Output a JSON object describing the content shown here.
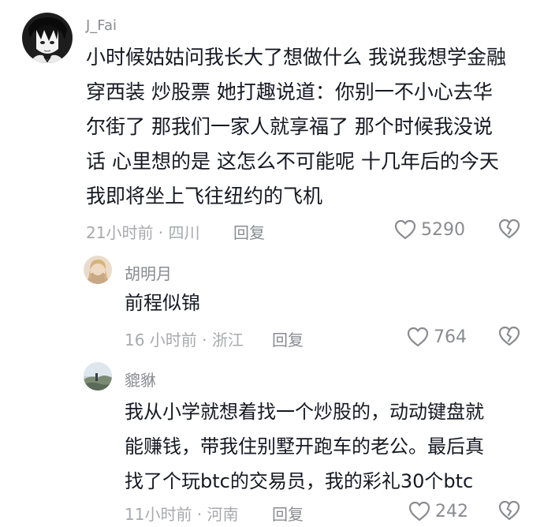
{
  "comments": [
    {
      "username": "J_Fai",
      "lines": [
        "小时候姑姑问我长大了想做什么 我说我想学金融",
        "穿西装 炒股票 她打趣说道：你别一不小心去华",
        "尔街了 那我们一家人就享福了 那个时候我没说",
        "话 心里想的是 这怎么不可能呢 十几年后的今天",
        "我即将坐上飞往纽约的飞机"
      ],
      "meta": "21小时前 · 四川",
      "reply_label": "回复",
      "likes": "5290"
    },
    {
      "username": "胡明月",
      "lines": [
        "前程似锦"
      ],
      "meta": "16 小时前 · 浙江",
      "reply_label": "回复",
      "likes": "764"
    },
    {
      "username": "貔貅",
      "lines": [
        "我从小学就想着找一个炒股的，动动键盘就",
        "能赚钱，带我住别墅开跑车的老公。最后真",
        "找了个玩btc的交易员，我的彩礼30个btc"
      ],
      "meta": "11小时前 · 河南",
      "reply_label": "回复",
      "likes": "242"
    }
  ],
  "icons": {
    "like": "heart-outline-icon",
    "dislike": "broken-heart-icon"
  },
  "colors": {
    "text": "#161823",
    "secondary": "#8a8b91",
    "meta": "#a8a9ad",
    "icon": "#8a8b91"
  }
}
